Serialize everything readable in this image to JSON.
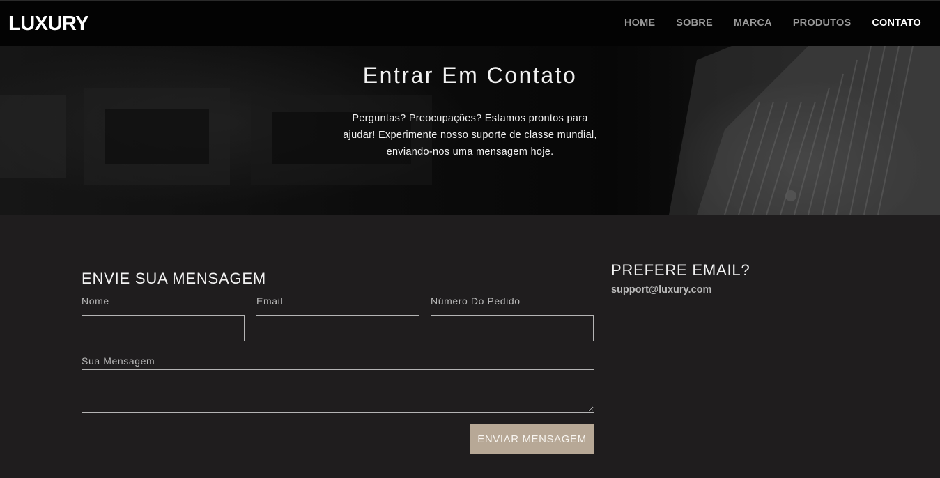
{
  "header": {
    "logo": "LUXURY",
    "nav": [
      {
        "label": "HOME",
        "active": false
      },
      {
        "label": "SOBRE",
        "active": false
      },
      {
        "label": "MARCA",
        "active": false
      },
      {
        "label": "PRODUTOS",
        "active": false
      },
      {
        "label": "CONTATO",
        "active": true
      }
    ]
  },
  "hero": {
    "title": "Entrar Em Contato",
    "text": "Perguntas? Preocupações? Estamos prontos para ajudar! Experimente nosso suporte de classe mundial, enviando-nos uma mensagem hoje."
  },
  "form": {
    "title": "ENVIE SUA MENSAGEM",
    "name_label": "Nome",
    "email_label": "Email",
    "order_label": "Número Do Pedido",
    "message_label": "Sua Mensagem",
    "submit_label": "ENVIAR MENSAGEM",
    "name_value": "",
    "email_value": "",
    "order_value": "",
    "message_value": ""
  },
  "aside": {
    "title": "PREFERE EMAIL?",
    "email": "support@luxury.com"
  },
  "colors": {
    "navbar_bg": "#030303",
    "page_bg": "#1f1d1e",
    "button_bg": "#b7a896",
    "active_nav": "#ffffff",
    "inactive_nav": "#9a9a9a"
  }
}
